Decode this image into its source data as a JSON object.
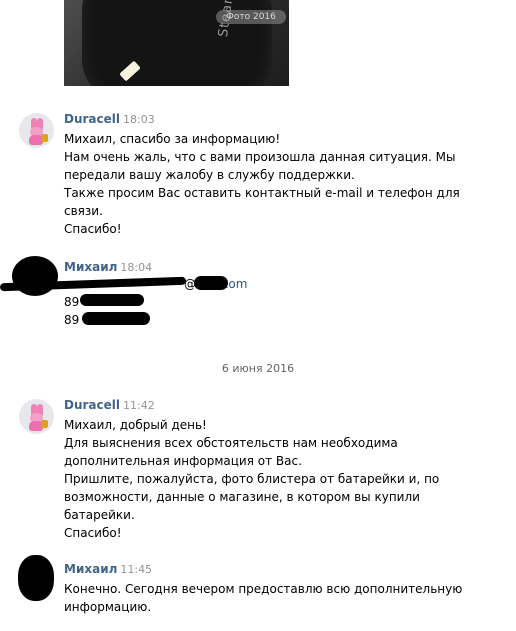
{
  "photo": {
    "brand_text": "Steam C",
    "stamp_text": "Фото 2016"
  },
  "messages": [
    {
      "sender": "Duracell",
      "time": "18:03",
      "lines": [
        "Михаил, спасибо за информацию!",
        "Нам очень жаль, что с вами произошла данная ситуация. Мы",
        "передали вашу жалобу в службу поддержки.",
        "Также просим Вас оставить контактный e-mail и телефон для",
        "связи.",
        "Спасибо!"
      ]
    },
    {
      "sender": "Михаил",
      "time": "18:04",
      "email_suffix": ".com",
      "email_at": "@",
      "phone_prefix_1": "89",
      "phone_prefix_2": "89"
    },
    {
      "sender": "Duracell",
      "time": "11:42",
      "lines": [
        "Михаил, добрый день!",
        "Для выяснения всех обстоятельств нам необходима",
        "дополнительная информация от Вас.",
        "Пришлите, пожалуйста, фото блистера от батарейки и, по",
        "возможности, данные о магазине, в котором вы купили",
        "батарейки.",
        "Спасибо!"
      ]
    },
    {
      "sender": "Михаил",
      "time": "11:45",
      "lines": [
        "Конечно. Сегодня вечером предоставлю всю дополнительную",
        "информацию."
      ]
    }
  ],
  "date_separator": "6 июня 2016"
}
